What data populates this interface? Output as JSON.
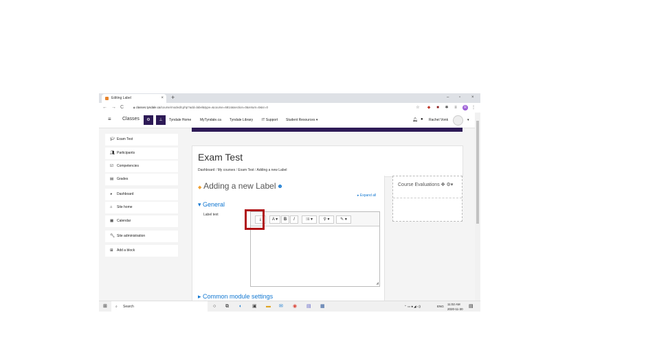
{
  "browser": {
    "tab_title": "Editing Label",
    "new_tab": "+",
    "window_controls": {
      "minimize": "–",
      "maximize": "▫",
      "close": "×"
    },
    "url_host": "classes.tyndale.ca",
    "url_path": "/course/modedit.php?add=label&type=&course=6814&section=0&return=0&sr=0",
    "profile_letter": "R"
  },
  "navbar": {
    "brand": "Classes",
    "links": [
      "Tyndale Home",
      "MyTyndale.ca",
      "Tyndale Library",
      "IT Support",
      "Student Resources ▾"
    ],
    "user_name": "Rachel Vonk"
  },
  "sidebar": {
    "items": [
      {
        "icon": "graduation-cap-icon",
        "label": "Exam Test"
      },
      {
        "icon": "users-icon",
        "label": "Participants"
      },
      {
        "icon": "checkbox-icon",
        "label": "Competencies"
      },
      {
        "icon": "table-icon",
        "label": "Grades"
      },
      {
        "icon": "dashboard-icon",
        "label": "Dashboard"
      },
      {
        "icon": "home-icon",
        "label": "Site home"
      },
      {
        "icon": "calendar-icon",
        "label": "Calendar"
      },
      {
        "icon": "wrench-icon",
        "label": "Site administration"
      },
      {
        "icon": "plus-square-icon",
        "label": "Add a block"
      }
    ]
  },
  "page": {
    "title": "Exam Test",
    "breadcrumb": [
      "Dashboard",
      "My courses",
      "Exam Test",
      "Adding a new Label"
    ],
    "heading": "Adding a new Label",
    "expand_all": "Expand all",
    "general_section": "General",
    "label_text_label": "Label text",
    "common_settings": "Common module settings"
  },
  "editor": {
    "toolbar": [
      "⤓",
      "A ▾",
      "B",
      "I",
      "⁝≡ ▾",
      "⚲ ▾",
      "✎ ▾"
    ]
  },
  "block": {
    "title": "Course Evaluations"
  },
  "taskbar": {
    "search_placeholder": "Search",
    "time": "11:02 AM",
    "date": "2020-11-30",
    "lang": "ENG"
  },
  "colors": {
    "brand_purple": "#2d1a56",
    "link_blue": "#1177d1",
    "highlight_red": "#b01014"
  }
}
